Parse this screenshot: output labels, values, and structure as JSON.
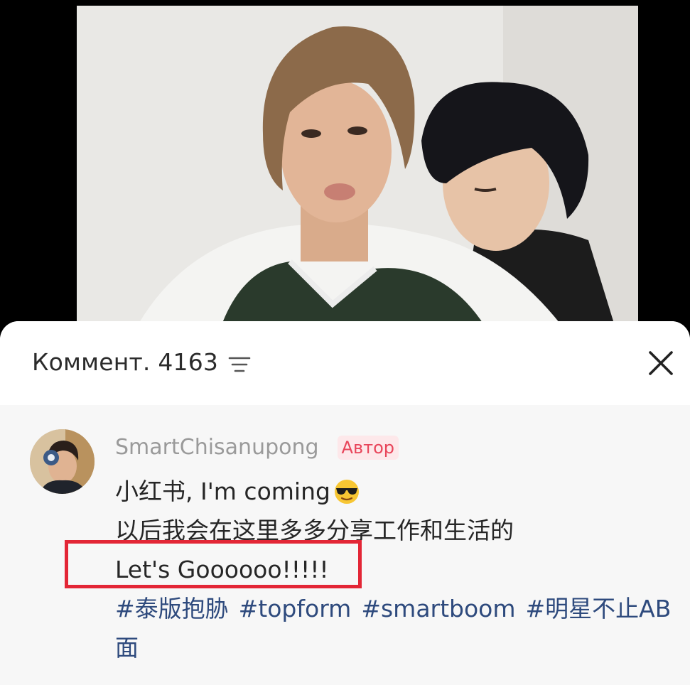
{
  "comments_panel": {
    "title": "Коммент.",
    "count": "4163",
    "sort_icon": "sort-lines-icon",
    "close_icon": "close-icon"
  },
  "comment": {
    "author": "SmartChisanupong",
    "badge": "Автор",
    "line1": "小红书, I'm coming",
    "line1_emoji": "sunglasses-emoji",
    "line2": "以后我会在这里多多分享工作和生活的",
    "line3": "Let's Goooooo!!!!!",
    "hashtags": [
      "#泰版抱胁",
      "#topform",
      "#smartboom",
      "#明星不止AB面"
    ]
  },
  "colors": {
    "badge": "#e8455a",
    "hashtag": "#2e4a7d",
    "highlight": "#e32636"
  }
}
